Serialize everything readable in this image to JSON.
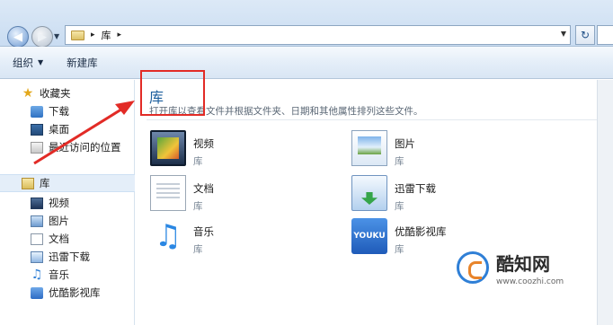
{
  "address": {
    "crumb": "库",
    "separator": "▸",
    "separator2": "▸"
  },
  "toolbar": {
    "organize": "组织",
    "new_library": "新建库"
  },
  "nav": {
    "favorites": "收藏夹",
    "downloads": "下载",
    "desktop": "桌面",
    "recent": "最近访问的位置",
    "library": "库",
    "lib_items": [
      "视频",
      "图片",
      "文档",
      "迅雷下载",
      "音乐",
      "优酷影视库"
    ]
  },
  "main": {
    "title": "库",
    "description": "打开库以查看文件并根据文件夹、日期和其他属性排列这些文件。",
    "tiles": [
      {
        "name": "视频",
        "sub": "库",
        "icon": "video-library-icon"
      },
      {
        "name": "图片",
        "sub": "库",
        "icon": "pictures-library-icon"
      },
      {
        "name": "文档",
        "sub": "库",
        "icon": "documents-library-icon"
      },
      {
        "name": "迅雷下载",
        "sub": "库",
        "icon": "xunlei-library-icon"
      },
      {
        "name": "音乐",
        "sub": "库",
        "icon": "music-library-icon"
      },
      {
        "name": "优酷影视库",
        "sub": "库",
        "icon": "youku-library-icon"
      }
    ],
    "youku_badge": "YOUKU"
  },
  "watermark": {
    "title": "酷知网",
    "url": "www.coozhi.com"
  },
  "colors": {
    "annotation_red": "#e22b26",
    "title_blue": "#1c5f9d"
  }
}
